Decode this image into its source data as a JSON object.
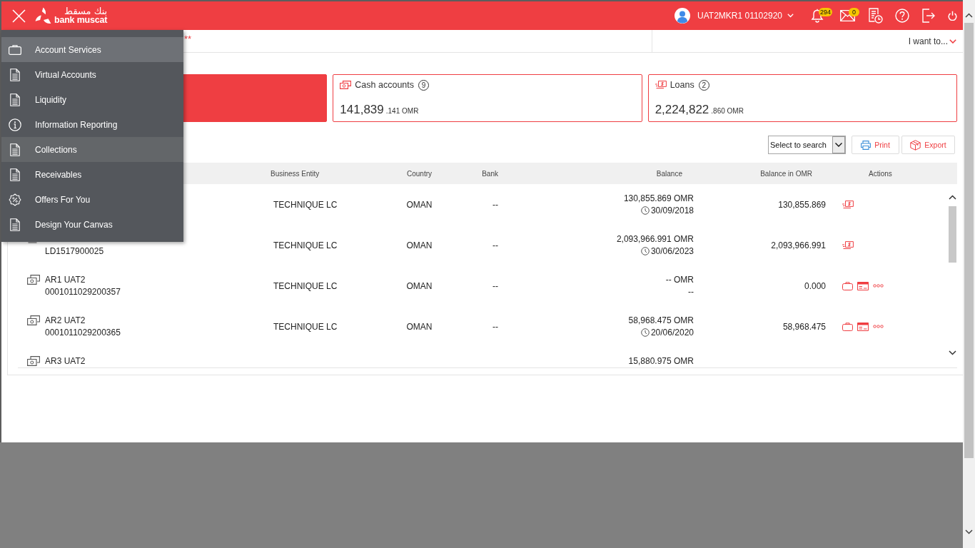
{
  "header": {
    "logo": {
      "arabic": "بنك مسقط",
      "latin": "bank muscat"
    },
    "user": {
      "name": "UAT2MKR1 01102920"
    },
    "notifications": {
      "count": "294"
    },
    "messages": {
      "count": "0"
    }
  },
  "menu": {
    "items": [
      {
        "label": "Account Services",
        "kind": "briefcase",
        "selected": true,
        "hovered": false
      },
      {
        "label": "Virtual Accounts",
        "kind": "document",
        "selected": false,
        "hovered": false
      },
      {
        "label": "Liquidity",
        "kind": "document",
        "selected": false,
        "hovered": false
      },
      {
        "label": "Information Reporting",
        "kind": "info",
        "selected": false,
        "hovered": false
      },
      {
        "label": "Collections",
        "kind": "document",
        "selected": false,
        "hovered": true
      },
      {
        "label": "Receivables",
        "kind": "document",
        "selected": false,
        "hovered": false
      },
      {
        "label": "Offers For You",
        "kind": "offer",
        "selected": false,
        "hovered": false
      },
      {
        "label": "Design Your Canvas",
        "kind": "document",
        "selected": false,
        "hovered": false
      }
    ]
  },
  "subbar": {
    "note": "**",
    "action_menu": "I want to..."
  },
  "summary_cards": [
    {
      "selected": true
    },
    {
      "kind": "cash",
      "label": "Cash accounts",
      "count": "9",
      "amount": "141,839",
      "decimals": ".141 OMR",
      "selected": false
    },
    {
      "kind": "loan",
      "label": "Loans",
      "count": "2",
      "amount": "2,224,822",
      "decimals": ".860 OMR",
      "selected": false
    }
  ],
  "toolbar": {
    "search_select": "Select to search",
    "buttons": [
      {
        "kind": "print",
        "label": "Print"
      },
      {
        "kind": "export",
        "label": "Export"
      }
    ]
  },
  "table": {
    "columns": [
      "Business Entity",
      "Country",
      "Bank",
      "Balance",
      "Balance in OMR",
      "Actions"
    ],
    "rows": [
      {
        "business_entity": "TECHNIQUE LC",
        "country": "OMAN",
        "bank": "--",
        "balance": {
          "amount": "130,855.869 OMR",
          "sub": {
            "kind": "date",
            "text": "30/09/2018"
          }
        },
        "balance_omr": "130,855.869",
        "actions": [
          {
            "kind": "transfer"
          }
        ]
      },
      {
        "account": {
          "kind": "loan",
          "number": "LD1517900025"
        },
        "business_entity": "TECHNIQUE LC",
        "country": "OMAN",
        "bank": "--",
        "balance": {
          "amount": "2,093,966.991 OMR",
          "sub": {
            "kind": "date",
            "text": "30/06/2023"
          }
        },
        "balance_omr": "2,093,966.991",
        "actions": [
          {
            "kind": "transfer"
          }
        ]
      },
      {
        "account": {
          "kind": "cash",
          "title": "AR1 UAT2",
          "number": "0001011029200357"
        },
        "business_entity": "TECHNIQUE LC",
        "country": "OMAN",
        "bank": "--",
        "balance": {
          "amount": "-- OMR",
          "sub": {
            "kind": "plain",
            "text": "--"
          }
        },
        "balance_omr": "0.000",
        "actions": [
          {
            "kind": "briefcase"
          },
          {
            "kind": "statement"
          },
          {
            "kind": "more"
          }
        ]
      },
      {
        "account": {
          "kind": "cash",
          "title": "AR2 UAT2",
          "number": "0001011029200365"
        },
        "business_entity": "TECHNIQUE LC",
        "country": "OMAN",
        "bank": "--",
        "balance": {
          "amount": "58,968.475 OMR",
          "sub": {
            "kind": "date",
            "text": "20/06/2020"
          }
        },
        "balance_omr": "58,968.475",
        "actions": [
          {
            "kind": "briefcase"
          },
          {
            "kind": "statement"
          },
          {
            "kind": "more"
          }
        ]
      },
      {
        "account": {
          "kind": "cash",
          "title": "AR3 UAT2"
        },
        "balance": {
          "amount": "15,880.975 OMR"
        }
      }
    ]
  }
}
